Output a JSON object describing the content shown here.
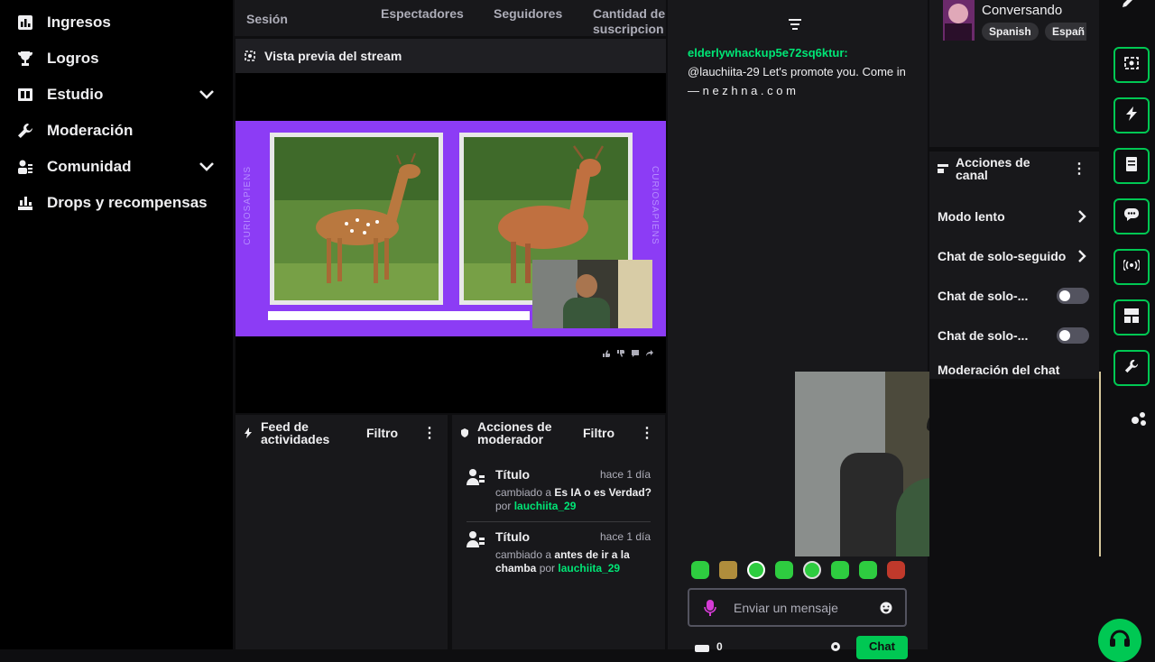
{
  "sidebar": {
    "items": [
      {
        "label": "Ingresos",
        "icon": "chart-icon",
        "has_chevron": false
      },
      {
        "label": "Logros",
        "icon": "trophy-icon",
        "has_chevron": false
      },
      {
        "label": "Estudio",
        "icon": "studio-icon",
        "has_chevron": true
      },
      {
        "label": "Moderación",
        "icon": "wrench-icon",
        "has_chevron": false
      },
      {
        "label": "Comunidad",
        "icon": "community-icon",
        "has_chevron": true
      },
      {
        "label": "Drops y recompensas",
        "icon": "drops-icon",
        "has_chevron": false
      }
    ]
  },
  "stats": {
    "session": "Sesión",
    "viewers": "Espectadores",
    "followers": "Seguidores",
    "subs": "Cantidad de suscripcion"
  },
  "preview": {
    "title": "Vista previa del stream",
    "watermark": "CURIOSAPIENS"
  },
  "activity_feed": {
    "title_line1": "Feed de",
    "title_line2": "actividades",
    "filter": "Filtro"
  },
  "mod_actions": {
    "title_line1": "Acciones de",
    "title_line2": "moderador",
    "filter": "Filtro",
    "entries": [
      {
        "label": "Título",
        "time": "hace 1 día",
        "changed": "cambiado a",
        "value": "Es IA o es Verdad?",
        "by": "por",
        "user": "lauchiita_29"
      },
      {
        "label": "Título",
        "time": "hace 1 día",
        "changed": "cambiado a",
        "value": "antes de ir a la chamba",
        "by": "por",
        "user": "lauchiita_29"
      }
    ]
  },
  "chat": {
    "message_user": "elderlywhackup5e72sq6ktur:",
    "message_text": "@lauchiita-29 Let's promote you. Come in — n e z h n a . c o m",
    "input_placeholder": "Enviar un mensaje",
    "send_label": "Chat",
    "points": "0"
  },
  "stream_info": {
    "category": "Conversando",
    "tags": [
      "Spanish",
      "Españ"
    ]
  },
  "channel_actions": {
    "title_line1": "Acciones de",
    "title_line2": "canal",
    "items": [
      {
        "label": "Modo lento",
        "control": "chevron"
      },
      {
        "label": "Chat de solo-seguido",
        "control": "chevron"
      },
      {
        "label": "Chat de solo-...",
        "control": "toggle"
      },
      {
        "label": "Chat de solo-...",
        "control": "toggle"
      },
      {
        "label": "Moderación del chat",
        "control": "none"
      }
    ]
  },
  "colors": {
    "accent_green": "#00c853",
    "purple": "#9146ff",
    "user_green": "#00e676"
  }
}
